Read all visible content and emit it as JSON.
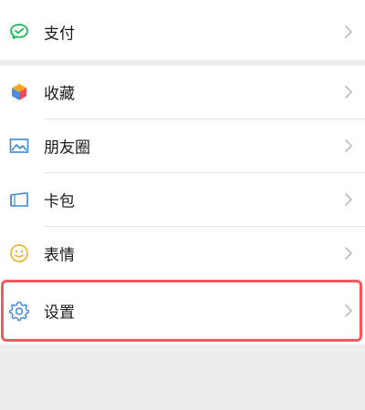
{
  "menu": {
    "pay": {
      "label": "支付",
      "icon": "wechat-pay-icon",
      "color": "#19b955"
    },
    "favorites": {
      "label": "收藏",
      "icon": "cube-icon"
    },
    "moments": {
      "label": "朋友圈",
      "icon": "photo-icon",
      "color": "#3f87d7"
    },
    "cards": {
      "label": "卡包",
      "icon": "card-wallet-icon",
      "color": "#3f87d7"
    },
    "stickers": {
      "label": "表情",
      "icon": "smiley-icon",
      "color": "#f2b233"
    },
    "settings": {
      "label": "设置",
      "icon": "gear-icon",
      "color": "#3f87d7"
    }
  },
  "highlight": {
    "target": "settings",
    "color": "#ef5a5f"
  }
}
